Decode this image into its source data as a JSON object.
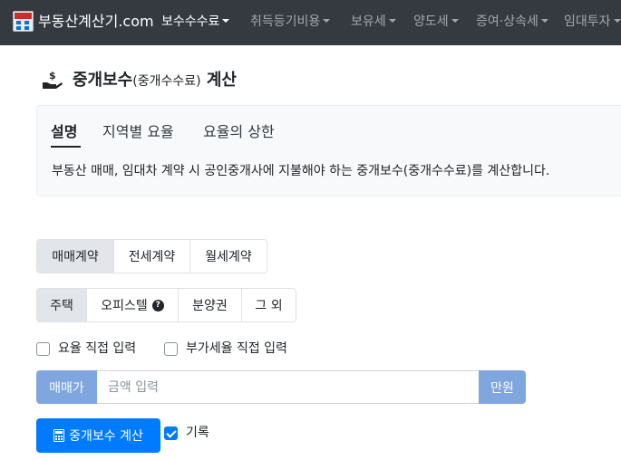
{
  "navbar": {
    "brand": "부동산계산기.com",
    "items": [
      {
        "label": "보수수수료"
      },
      {
        "label": "취득등기비용"
      },
      {
        "label": "보유세"
      },
      {
        "label": "양도세"
      },
      {
        "label": "증여·상속세"
      },
      {
        "label": "임대투자"
      }
    ]
  },
  "page": {
    "title_main": "중개보수",
    "title_paren": "(중개수수료)",
    "title_tail": " 계산"
  },
  "info_card": {
    "tabs": [
      {
        "label": "설명"
      },
      {
        "label": "지역별 요율"
      },
      {
        "label": "요율의 상한"
      }
    ],
    "description": "부동산 매매, 임대차 계약 시 공인중개사에 지불해야 하는 중개보수(중개수수료)를 계산합니다."
  },
  "contract_types": {
    "options": [
      {
        "label": "매매계약"
      },
      {
        "label": "전세계약"
      },
      {
        "label": "월세계약"
      }
    ]
  },
  "property_types": {
    "options": [
      {
        "label": "주택"
      },
      {
        "label": "오피스텔"
      },
      {
        "label": "분양권"
      },
      {
        "label": "그 외"
      }
    ]
  },
  "options": {
    "rate_direct": "요율 직접 입력",
    "vat_direct": "부가세율 직접 입력",
    "record": "기록"
  },
  "price_input": {
    "label": "매매가",
    "placeholder": "금액 입력",
    "unit": "만원"
  },
  "calc_button": "중개보수 계산"
}
